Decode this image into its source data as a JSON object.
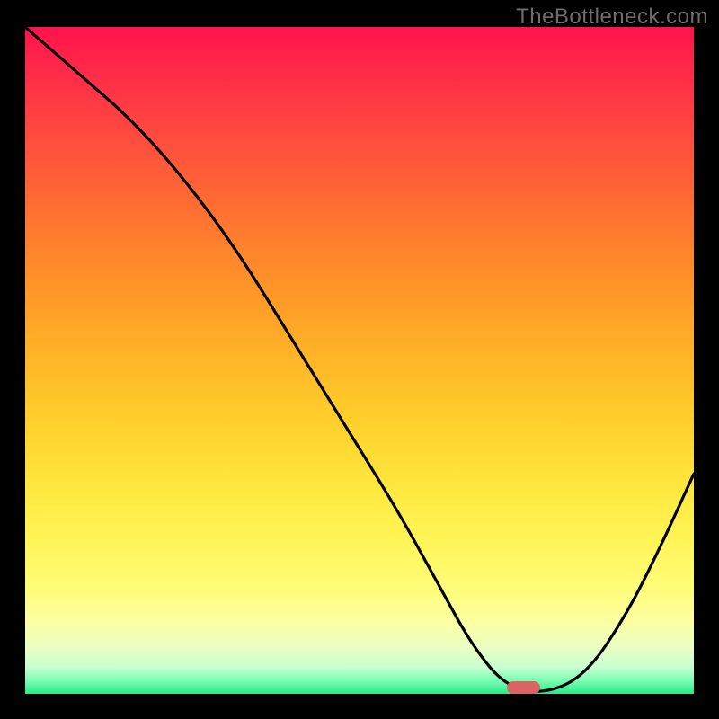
{
  "watermark": "TheBottleneck.com",
  "chart_data": {
    "type": "line",
    "title": "",
    "xlabel": "",
    "ylabel": "",
    "xlim": [
      0,
      100
    ],
    "ylim": [
      0,
      100
    ],
    "grid": false,
    "background": "red-yellow-green vertical gradient",
    "series": [
      {
        "name": "curve",
        "x": [
          0,
          8,
          16,
          24,
          32,
          40,
          48,
          56,
          62,
          67,
          72,
          78,
          84,
          90,
          95,
          100
        ],
        "y": [
          100,
          93,
          86,
          77,
          66,
          53,
          40,
          27,
          16,
          7,
          1,
          0,
          3,
          12,
          22,
          33
        ]
      }
    ],
    "marker": {
      "x": 74.5,
      "y": 1.0,
      "width_pct": 5.0,
      "color": "#da6363"
    }
  }
}
